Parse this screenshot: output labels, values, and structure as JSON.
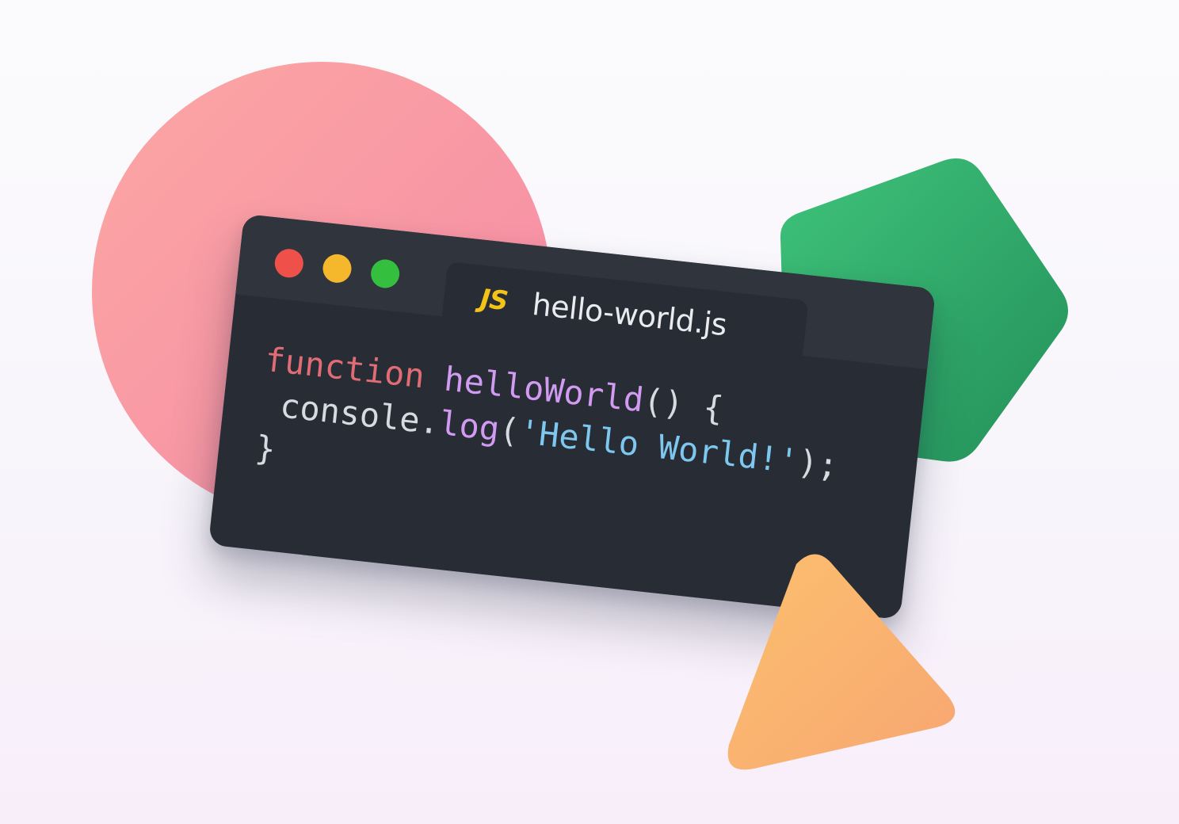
{
  "editor": {
    "filename": "hello-world.js",
    "file_icon_text": "JS",
    "code_lines": [
      [
        {
          "text": "function",
          "role": "keyword"
        },
        {
          "text": " ",
          "role": "plain"
        },
        {
          "text": "helloWorld",
          "role": "function"
        },
        {
          "text": "() {",
          "role": "plain"
        }
      ],
      [
        {
          "text": " console.",
          "role": "plain"
        },
        {
          "text": "log",
          "role": "method"
        },
        {
          "text": "(",
          "role": "plain"
        },
        {
          "text": "'Hello World!'",
          "role": "string"
        },
        {
          "text": ");",
          "role": "plain"
        }
      ],
      [
        {
          "text": "}",
          "role": "plain"
        }
      ]
    ]
  },
  "colors": {
    "window_bg": "#282c34",
    "titlebar_bg": "#30353d",
    "dot_red": "#f0504a",
    "dot_yellow": "#f5b72c",
    "dot_green": "#34c03e",
    "js_icon": "#f3c218",
    "keyword": "#e06c75",
    "function": "#d19bf2",
    "method": "#d19bf2",
    "string": "#7ec8f0",
    "plain": "#d7dae0",
    "circle": "#f68fa1",
    "pentagon": "#2faa68",
    "triangle": "#f8b36e"
  },
  "decorations": [
    {
      "name": "circle-shape",
      "shape": "circle"
    },
    {
      "name": "pentagon-shape",
      "shape": "pentagon"
    },
    {
      "name": "triangle-shape",
      "shape": "triangle"
    }
  ]
}
